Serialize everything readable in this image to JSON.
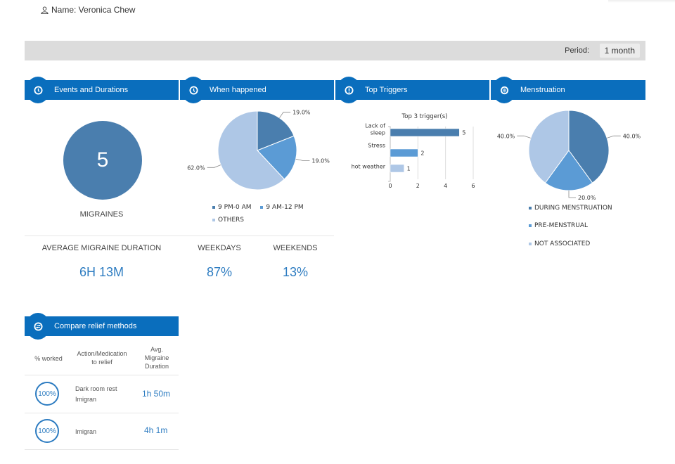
{
  "header": {
    "name_label": "Name: Veronica Chew",
    "period_label": "Period:",
    "period_value": "1 month"
  },
  "colors": {
    "accent": "#0a6ebd",
    "dark": "#4a7eae",
    "medium": "#5b9bd5",
    "light": "#aec7e6",
    "value_text": "#2d7cc1"
  },
  "panels": {
    "events": {
      "title": "Events and Durations",
      "icon": "clock-icon",
      "count": "5",
      "count_label": "MIGRAINES",
      "avg_label": "AVERAGE MIGRAINE DURATION",
      "avg_value": "6H 13M"
    },
    "when": {
      "title": "When happened",
      "icon": "clock-icon",
      "weekdays_label": "WEEKDAYS",
      "weekdays_value": "87%",
      "weekends_label": "WEEKENDS",
      "weekends_value": "13%"
    },
    "triggers": {
      "title": "Top Triggers",
      "icon": "alert-icon"
    },
    "menstruation": {
      "title": "Menstruation",
      "icon": "calendar-icon"
    },
    "relief": {
      "title": "Compare relief methods",
      "icon": "compare-icon",
      "col_worked": "% worked",
      "col_action_1": "Action/Medication",
      "col_action_2": "to relief",
      "col_dur_1": "Avg.",
      "col_dur_2": "Migraine",
      "col_dur_3": "Duration",
      "rows": [
        {
          "worked": "100%",
          "action_1": "Dark room rest",
          "action_2": "Imigran",
          "duration": "1h 50m"
        },
        {
          "worked": "100%",
          "action_1": "Imigran",
          "action_2": "",
          "duration": "4h 1m"
        }
      ]
    }
  },
  "chart_data": [
    {
      "type": "pie",
      "title": "When happened",
      "categories": [
        "9 PM-0 AM",
        "9 AM-12 PM",
        "OTHERS"
      ],
      "values": [
        19.0,
        19.0,
        62.0
      ],
      "labels": [
        "19.0%",
        "19.0%",
        "62.0%"
      ],
      "colors": [
        "#4a7eae",
        "#5b9bd5",
        "#aec7e6"
      ],
      "legend": "bottom"
    },
    {
      "type": "bar",
      "orientation": "horizontal",
      "title": "Top 3 trigger(s)",
      "categories": [
        "Lack of sleep",
        "Stress",
        "hot weather"
      ],
      "values": [
        5,
        2,
        1
      ],
      "colors": [
        "#4a7eae",
        "#5b9bd5",
        "#aec7e6"
      ],
      "xlim": [
        0,
        6
      ],
      "xticks": [
        "0",
        "2",
        "4",
        "6"
      ],
      "grid": true
    },
    {
      "type": "pie",
      "title": "Menstruation",
      "categories": [
        "DURING MENSTRUATION",
        "PRE-MENSTRUAL",
        "NOT ASSOCIATED"
      ],
      "values": [
        40.0,
        20.0,
        40.0
      ],
      "labels": [
        "40.0%",
        "20.0%",
        "40.0%"
      ],
      "colors": [
        "#4a7eae",
        "#5b9bd5",
        "#aec7e6"
      ],
      "legend": "bottom"
    }
  ]
}
